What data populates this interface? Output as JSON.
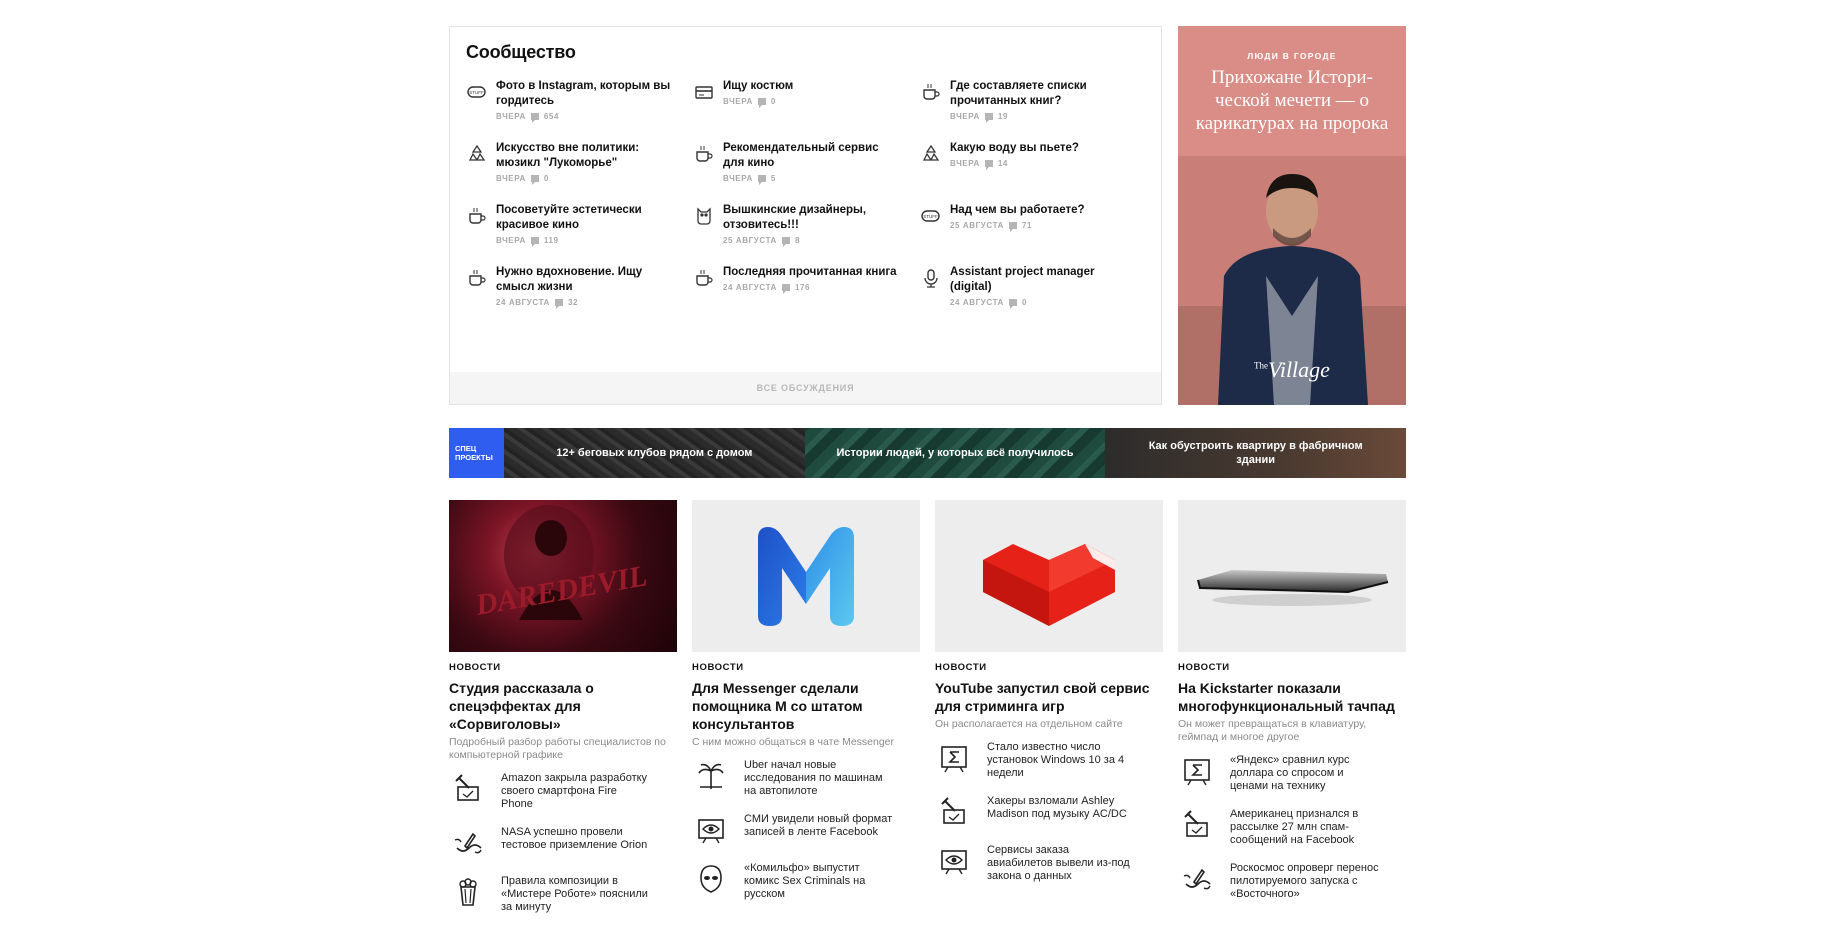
{
  "community": {
    "title": "Сообщество",
    "topics": [
      {
        "icon": "stuff-icon",
        "title": "Фото в Instagram, которым вы гордитесь",
        "date": "вчера",
        "comments": "654"
      },
      {
        "icon": "card-icon",
        "title": "Ищу костюм",
        "date": "вчера",
        "comments": "0"
      },
      {
        "icon": "coffee-cup-icon",
        "title": "Где составляете списки прочитанных книг?",
        "date": "вчера",
        "comments": "19"
      },
      {
        "icon": "recycle-icon",
        "title": "Искусство вне политики: мюзикл \"Лукоморье\"",
        "date": "вчера",
        "comments": "0"
      },
      {
        "icon": "coffee-cup-icon",
        "title": "Рекомендательный сервис для кино",
        "date": "вчера",
        "comments": "5"
      },
      {
        "icon": "recycle-icon",
        "title": "Какую воду вы пьете?",
        "date": "вчера",
        "comments": "14"
      },
      {
        "icon": "coffee-cup-icon",
        "title": "Посоветуйте эстетически красивое кино",
        "date": "вчера",
        "comments": "119"
      },
      {
        "icon": "owl-icon",
        "title": "Вышкинские дизайнеры, отзовитесь!!!",
        "date": "25 августа",
        "comments": "8"
      },
      {
        "icon": "stuff-icon",
        "title": "Над чем вы работаете?",
        "date": "25 августа",
        "comments": "71"
      },
      {
        "icon": "coffee-cup-icon",
        "title": "Нужно вдохновение. Ищу смысл жизни",
        "date": "24 августа",
        "comments": "32"
      },
      {
        "icon": "coffee-cup-icon",
        "title": "Последняя прочитанная книга",
        "date": "24 августа",
        "comments": "176"
      },
      {
        "icon": "microphone-icon",
        "title": "Assistant project manager (digital)",
        "date": "24 августа",
        "comments": "0"
      }
    ],
    "all_link": "Все обсуждения"
  },
  "promo": {
    "kicker": "Люди в городе",
    "headline": "Прихожане Истори-ческой мечети — о карикатурах на пророка",
    "brand": "Village",
    "brand_sup": "The"
  },
  "spec": {
    "badge": "Спец проекты",
    "projects": [
      "12+ беговых клубов рядом с домом",
      "Истории людей, у которых всё получилось",
      "Как обустроить квартиру в фабричном здании"
    ]
  },
  "news": [
    {
      "category": "Новости",
      "title": "Студия рассказала о спецэффектах для «Сорвиголовы»",
      "lead": "Подробный разбор работы специалистов по компьютерной графике",
      "thumb_text": "DAREDEVIL",
      "related": [
        {
          "icon": "hammer-box-icon",
          "text": "Amazon закрыла разработку своего смартфона Fire Phone"
        },
        {
          "icon": "rocket-splash-icon",
          "text": "NASA успешно провели тестовое приземление Orion"
        },
        {
          "icon": "popcorn-icon",
          "text": "Правила композиции в «Мистере Роботе» пояснили за минуту"
        }
      ]
    },
    {
      "category": "Новости",
      "title": "Для Messenger сделали помощника M со штатом консультантов",
      "lead": "С ним можно общаться в чате Messenger",
      "related": [
        {
          "icon": "palm-car-icon",
          "text": "Uber начал новые исследования по машинам на автопилоте"
        },
        {
          "icon": "eye-board-icon",
          "text": "СМИ увидели новый формат записей в ленте Facebook"
        },
        {
          "icon": "alien-icon",
          "text": "«Комильфо» выпустит комикс Sex Criminals на русском"
        }
      ]
    },
    {
      "category": "Новости",
      "title": "YouTube запустил свой сервис для стриминга игр",
      "lead": "Он располагается на отдельном сайте",
      "related": [
        {
          "icon": "sigma-board-icon",
          "text": "Стало известно число установок Windows 10 за 4 недели"
        },
        {
          "icon": "hammer-box-icon",
          "text": "Хакеры взломали Ashley Madison под музыку AC/DC"
        },
        {
          "icon": "eye-board-icon",
          "text": "Сервисы заказа авиабилетов вывели из-под закона о данных"
        }
      ]
    },
    {
      "category": "Новости",
      "title": "На Kickstarter показали многофункциональный тачпад",
      "lead": "Он может превращаться в клавиатуру, геймпад и многое другое",
      "related": [
        {
          "icon": "sigma-board-icon",
          "text": "«Яндекс» сравнил курс доллара со спросом и ценами на технику"
        },
        {
          "icon": "hammer-box-icon",
          "text": "Американец признался в рассылке 27 млн спам-сообщений на Facebook"
        },
        {
          "icon": "rocket-splash-icon",
          "text": "Роскосмос опроверг перенос пилотируемого запуска с «Восточного»"
        }
      ]
    }
  ],
  "colors": {
    "spec_badge": "#2f5df0",
    "promo_bg": "#d98d86",
    "youtube_red": "#e62117"
  }
}
